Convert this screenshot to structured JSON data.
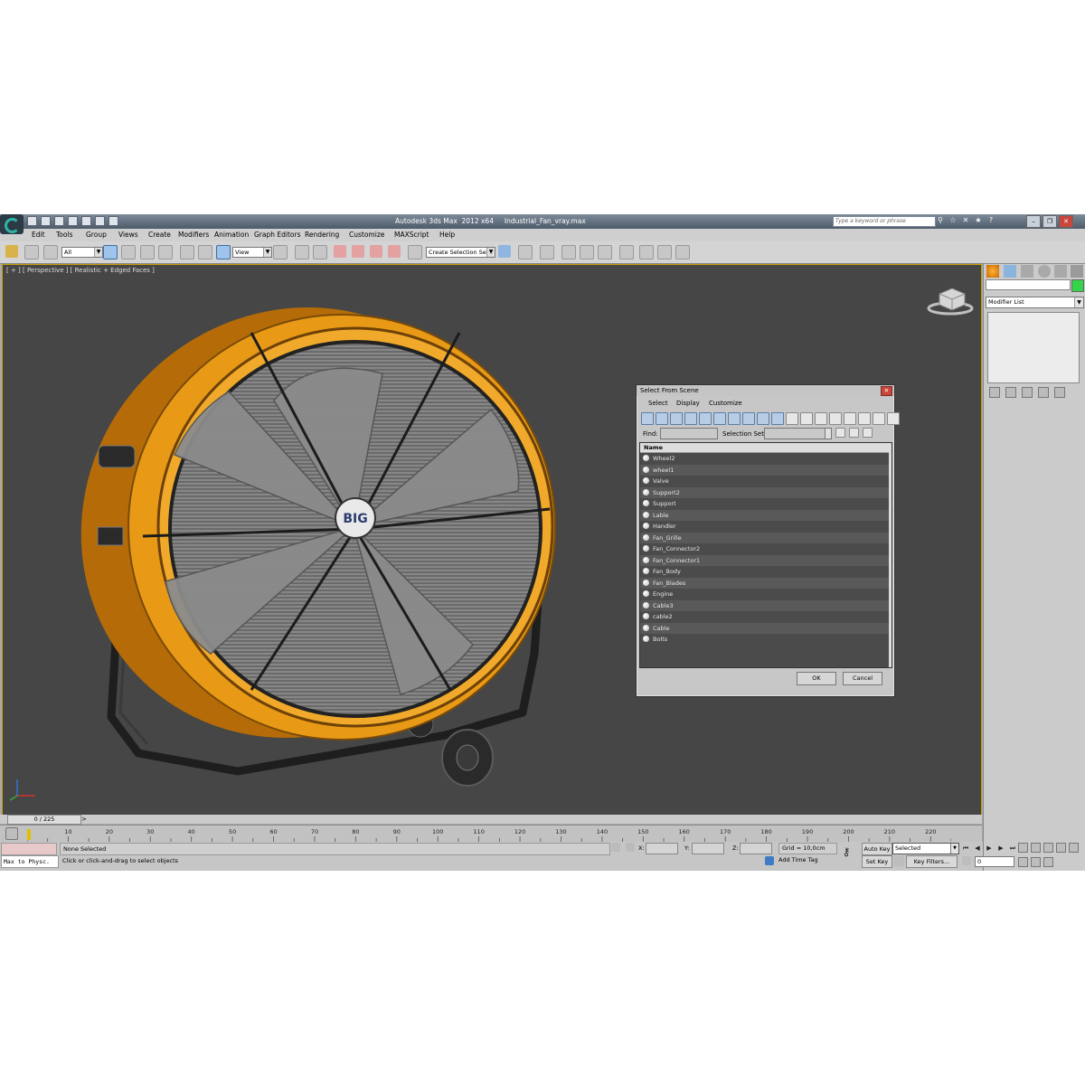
{
  "window": {
    "title": "Autodesk 3ds Max  2012 x64     Industrial_Fan_vray.max",
    "search_placeholder": "Type a keyword or phrase"
  },
  "menu": [
    "Edit",
    "Tools",
    "Group",
    "Views",
    "Create",
    "Modifiers",
    "Animation",
    "Graph Editors",
    "Rendering",
    "Customize",
    "MAXScript",
    "Help"
  ],
  "toolbar": {
    "selection_filter": "All",
    "reference_coord": "View",
    "named_selection": "Create Selection Se"
  },
  "viewport": {
    "label": "[ + ] [ Perspective ] [ Realistic + Edged Faces ]",
    "fan_logo": "BIG",
    "fan_color": "#e89a16",
    "frame_color": "#222222",
    "background": "#464646"
  },
  "command_panel": {
    "modifier_list": "Modifier List",
    "object_color": "#35d44b"
  },
  "dialog": {
    "title": "Select From Scene",
    "menu": [
      "Select",
      "Display",
      "Customize"
    ],
    "find_label": "Find:",
    "selection_set_label": "Selection Set:",
    "column_header": "Name",
    "items": [
      "Wheel2",
      "wheel1",
      "Valve",
      "Support2",
      "Support",
      "Lable",
      "Handler",
      "Fan_Grille",
      "Fan_Connector2",
      "Fan_Connector1",
      "Fan_Body",
      "Fan_Blades",
      "Engine",
      "Cable3",
      "cable2",
      "Cable",
      "Bolts"
    ],
    "ok": "OK",
    "cancel": "Cancel"
  },
  "timeline": {
    "frame_display": "0 / 225",
    "next_arrow": ">",
    "ticks": [
      "10",
      "20",
      "30",
      "40",
      "50",
      "60",
      "70",
      "80",
      "90",
      "100",
      "110",
      "120",
      "130",
      "140",
      "150",
      "160",
      "170",
      "180",
      "190",
      "200",
      "210",
      "220"
    ]
  },
  "status": {
    "maxscript_label": "Max to Physc.",
    "selection": "None Selected",
    "prompt": "Click or click-and-drag to select objects",
    "x_label": "X:",
    "y_label": "Y:",
    "z_label": "Z:",
    "grid": "Grid = 10,0cm",
    "add_time_tag": "Add Time Tag",
    "auto_key": "Auto Key",
    "set_key": "Set Key",
    "key_mode": "Selected",
    "key_filters": "Key Filters...",
    "current_frame": "0"
  }
}
